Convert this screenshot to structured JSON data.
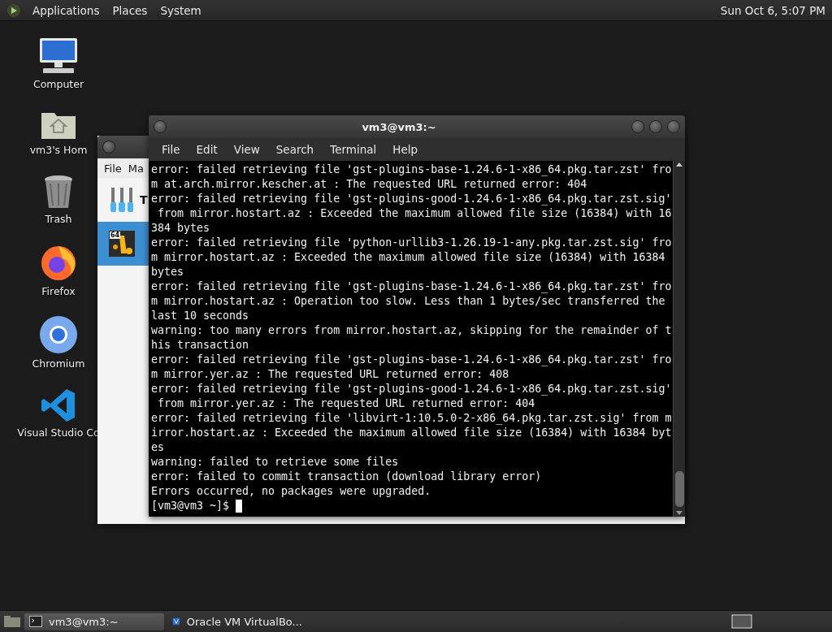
{
  "top_panel": {
    "menus": [
      "Applications",
      "Places",
      "System"
    ],
    "clock": "Sun Oct 6, 5:07 PM"
  },
  "desktop_icons": [
    {
      "kind": "computer",
      "label": "Computer"
    },
    {
      "kind": "home",
      "label": "vm3's Hom"
    },
    {
      "kind": "trash",
      "label": "Trash"
    },
    {
      "kind": "firefox",
      "label": "Firefox"
    },
    {
      "kind": "chromium",
      "label": "Chromium"
    },
    {
      "kind": "vscode",
      "label": "Visual Studio Co"
    }
  ],
  "background_window": {
    "menus": [
      "File",
      "Ma"
    ],
    "items": [
      {
        "kind": "tools",
        "label": "T",
        "selected": false
      },
      {
        "kind": "vm",
        "badge": "64",
        "selected": true
      }
    ]
  },
  "terminal": {
    "title": "vm3@vm3:~",
    "menus": [
      "File",
      "Edit",
      "View",
      "Search",
      "Terminal",
      "Help"
    ],
    "lines": [
      "error: failed retrieving file 'gst-plugins-base-1.24.6-1-x86_64.pkg.tar.zst' fro",
      "m at.arch.mirror.kescher.at : The requested URL returned error: 404",
      "error: failed retrieving file 'gst-plugins-good-1.24.6-1-x86_64.pkg.tar.zst.sig'",
      " from mirror.hostart.az : Exceeded the maximum allowed file size (16384) with 16",
      "384 bytes",
      "error: failed retrieving file 'python-urllib3-1.26.19-1-any.pkg.tar.zst.sig' fro",
      "m mirror.hostart.az : Exceeded the maximum allowed file size (16384) with 16384",
      "bytes",
      "error: failed retrieving file 'gst-plugins-base-1.24.6-1-x86_64.pkg.tar.zst' fro",
      "m mirror.hostart.az : Operation too slow. Less than 1 bytes/sec transferred the",
      "last 10 seconds",
      "warning: too many errors from mirror.hostart.az, skipping for the remainder of t",
      "his transaction",
      "error: failed retrieving file 'gst-plugins-base-1.24.6-1-x86_64.pkg.tar.zst' fro",
      "m mirror.yer.az : The requested URL returned error: 408",
      "error: failed retrieving file 'gst-plugins-good-1.24.6-1-x86_64.pkg.tar.zst.sig'",
      " from mirror.yer.az : The requested URL returned error: 404",
      "error: failed retrieving file 'libvirt-1:10.5.0-2-x86_64.pkg.tar.zst.sig' from m",
      "irror.hostart.az : Exceeded the maximum allowed file size (16384) with 16384 byt",
      "es",
      "warning: failed to retrieve some files",
      "error: failed to commit transaction (download library error)",
      "Errors occurred, no packages were upgraded."
    ],
    "prompt": "[vm3@vm3 ~]$"
  },
  "taskbar": {
    "items": [
      {
        "kind": "terminal",
        "label": "vm3@vm3:~",
        "selected": true
      },
      {
        "kind": "virtualbox",
        "label": "Oracle VM VirtualBo...",
        "selected": false
      }
    ]
  }
}
